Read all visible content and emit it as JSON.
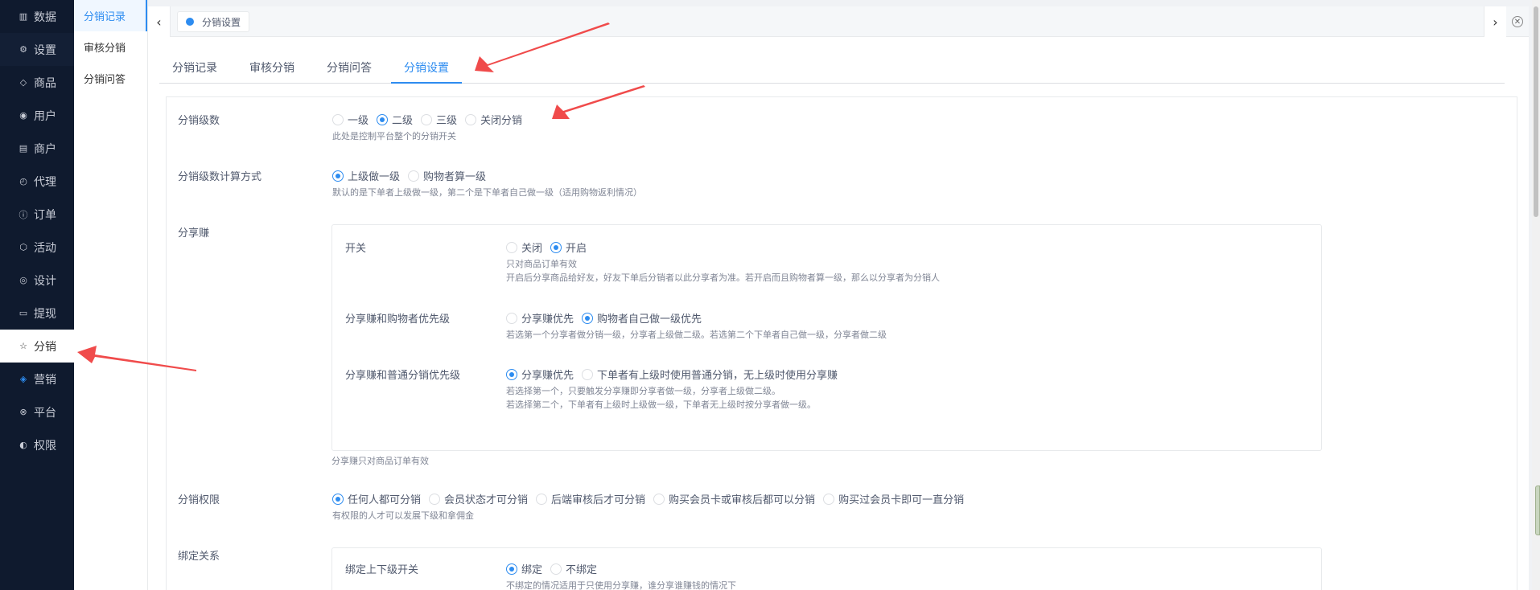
{
  "nav": {
    "items": [
      {
        "label": "数据",
        "icon": "bar-chart-icon"
      },
      {
        "label": "设置",
        "icon": "gear-icon"
      },
      {
        "label": "商品",
        "icon": "box-icon"
      },
      {
        "label": "用户",
        "icon": "user-icon"
      },
      {
        "label": "商户",
        "icon": "store-icon"
      },
      {
        "label": "代理",
        "icon": "clock-icon"
      },
      {
        "label": "订单",
        "icon": "info-icon"
      },
      {
        "label": "活动",
        "icon": "tag-icon"
      },
      {
        "label": "设计",
        "icon": "palette-icon"
      },
      {
        "label": "提现",
        "icon": "card-icon"
      },
      {
        "label": "分销",
        "icon": "star-icon"
      },
      {
        "label": "营销",
        "icon": "layers-icon"
      },
      {
        "label": "平台",
        "icon": "xbox-icon"
      },
      {
        "label": "权限",
        "icon": "compass-icon"
      }
    ],
    "active_index": 10
  },
  "subnav": {
    "items": [
      "分销记录",
      "审核分销",
      "分销问答"
    ],
    "active_index": 0
  },
  "topbar": {
    "tag_label": "分销设置"
  },
  "tabs": {
    "items": [
      "分销记录",
      "审核分销",
      "分销问答",
      "分销设置"
    ],
    "active_index": 3
  },
  "form": {
    "level": {
      "label": "分销级数",
      "options": [
        "一级",
        "二级",
        "三级",
        "关闭分销"
      ],
      "selected": 1,
      "tip": "此处是控制平台整个的分销开关"
    },
    "calc": {
      "label": "分销级数计算方式",
      "options": [
        "上级做一级",
        "购物者算一级"
      ],
      "selected": 0,
      "tip": "默认的是下单者上级做一级，第二个是下单者自己做一级（适用购物返利情况）"
    },
    "share": {
      "label": "分享赚",
      "switch": {
        "label": "开关",
        "options": [
          "关闭",
          "开启"
        ],
        "selected": 1,
        "tip1": "只对商品订单有效",
        "tip2": "开启后分享商品给好友，好友下单后分销者以此分享者为准。若开启而且购物者算一级，那么以分享者为分销人"
      },
      "buyer_priority": {
        "label": "分享赚和购物者优先级",
        "options": [
          "分享赚优先",
          "购物者自己做一级优先"
        ],
        "selected": 1,
        "tip": "若选第一个分享者做分销一级，分享者上级做二级。若选第二个下单者自己做一级，分享者做二级"
      },
      "normal_priority": {
        "label": "分享赚和普通分销优先级",
        "options": [
          "分享赚优先",
          "下单者有上级时使用普通分销，无上级时使用分享赚"
        ],
        "selected": 0,
        "tip1": "若选择第一个，只要触发分享赚即分享者做一级，分享者上级做二级。",
        "tip2": "若选择第二个，下单者有上级时上级做一级，下单者无上级时按分享者做一级。"
      },
      "footer_tip": "分享赚只对商品订单有效"
    },
    "permission": {
      "label": "分销权限",
      "options": [
        "任何人都可分销",
        "会员状态才可分销",
        "后端审核后才可分销",
        "购买会员卡或审核后都可以分销",
        "购买过会员卡即可一直分销"
      ],
      "selected": 0,
      "tip": "有权限的人才可以发展下级和拿佣金"
    },
    "bind": {
      "label": "绑定关系",
      "switch_label": "绑定上下级开关",
      "options": [
        "绑定",
        "不绑定"
      ],
      "selected": 0,
      "tip": "不绑定的情况适用于只使用分享赚，谁分享谁赚钱的情况下"
    }
  },
  "colors": {
    "accent": "#2d8cf0",
    "nav_bg": "#0f1a2e",
    "annotation_arrow": "#f04b4b"
  }
}
